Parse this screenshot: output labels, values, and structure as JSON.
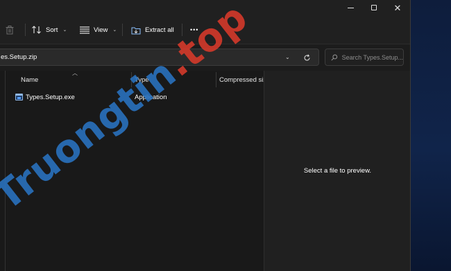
{
  "window": {
    "controls": {
      "minimize": "minimize",
      "maximize": "maximize",
      "close": "close"
    }
  },
  "commandbar": {
    "sort_label": "Sort",
    "view_label": "View",
    "extract_label": "Extract all",
    "more_label": "•••"
  },
  "address": {
    "path": "es.Setup.zip",
    "search_placeholder": "Search Types.Setup..."
  },
  "columns": [
    "Name",
    "Type",
    "Compressed size"
  ],
  "files": [
    {
      "name": "Types.Setup.exe",
      "type": "Application"
    }
  ],
  "preview": {
    "message": "Select a file to preview."
  },
  "watermark": {
    "part1": "Truongtin",
    "part2": ".top"
  },
  "colors": {
    "accent": "#2a74c2",
    "watermark_red": "#d93a2b",
    "background": "#191919"
  }
}
